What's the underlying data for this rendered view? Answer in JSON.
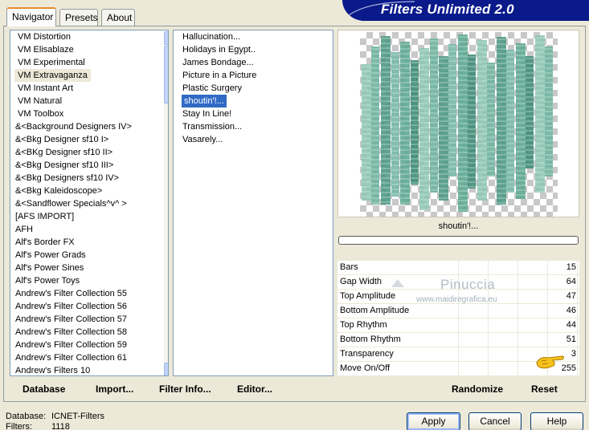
{
  "title": "Filters Unlimited 2.0",
  "tabs": [
    {
      "label": "Navigator",
      "active": true
    },
    {
      "label": "Presets",
      "active": false
    },
    {
      "label": "About",
      "active": false
    }
  ],
  "categories": {
    "items": [
      "VM Distortion",
      "VM Elisablaze",
      "VM Experimental",
      "VM Extravaganza",
      "VM Instant Art",
      "VM Natural",
      "VM Toolbox",
      "&<Background Designers IV>",
      "&<Bkg Designer sf10 I>",
      "&<BKg Designer sf10 II>",
      "&<Bkg Designer sf10 III>",
      "&<Bkg Designers sf10 IV>",
      "&<Bkg Kaleidoscope>",
      "&<Sandflower Specials^v^ >",
      "[AFS IMPORT]",
      "AFH",
      "Alf's Border FX",
      "Alf's Power Grads",
      "Alf's Power Sines",
      "Alf's Power Toys",
      "Andrew's Filter Collection 55",
      "Andrew's Filter Collection 56",
      "Andrew's Filter Collection 57",
      "Andrew's Filter Collection 58",
      "Andrew's Filter Collection 59",
      "Andrew's Filter Collection 61",
      "Andrew's Filters 10"
    ],
    "selected": "VM Extravaganza"
  },
  "filters": {
    "items": [
      "Hallucination...",
      "Holidays in Egypt..",
      "James Bondage...",
      "Picture in a Picture",
      "Plastic Surgery",
      "shoutin'!...",
      "Stay In Line!",
      "Transmission...",
      "Vasarely..."
    ],
    "selected": "shoutin'!..."
  },
  "preview": {
    "filter_name": "shoutin'!...",
    "progress": 0
  },
  "params": [
    {
      "label": "Bars",
      "value": "15"
    },
    {
      "label": "Gap Width",
      "value": "64"
    },
    {
      "label": "Top Amplitude",
      "value": "47"
    },
    {
      "label": "Bottom Amplitude",
      "value": "46"
    },
    {
      "label": "Top Rhythm",
      "value": "44"
    },
    {
      "label": "Bottom Rhythm",
      "value": "51"
    },
    {
      "label": "Transparency",
      "value": "3"
    },
    {
      "label": "Move On/Off",
      "value": "255"
    }
  ],
  "watermark": {
    "name": "Pinuccia",
    "url": "www.maidiregrafica.eu"
  },
  "bottom_buttons": {
    "database": "Database",
    "import": "Import...",
    "filter_info": "Filter Info...",
    "editor": "Editor...",
    "randomize": "Randomize",
    "reset": "Reset"
  },
  "status": {
    "database_label": "Database:",
    "database_value": "ICNET-Filters",
    "filters_label": "Filters:",
    "filters_value": "1118"
  },
  "dialog_buttons": {
    "apply": "Apply",
    "cancel": "Cancel",
    "help": "Help"
  },
  "colors": {
    "banner": "#0a1a8a",
    "selection": "#316ac5",
    "preview_bars": "#5a9e8c"
  },
  "icons": {
    "pointing_hand": "pointing-hand-icon",
    "scroll_up": "scroll-up-arrow-icon",
    "scroll_down": "scroll-down-arrow-icon"
  }
}
